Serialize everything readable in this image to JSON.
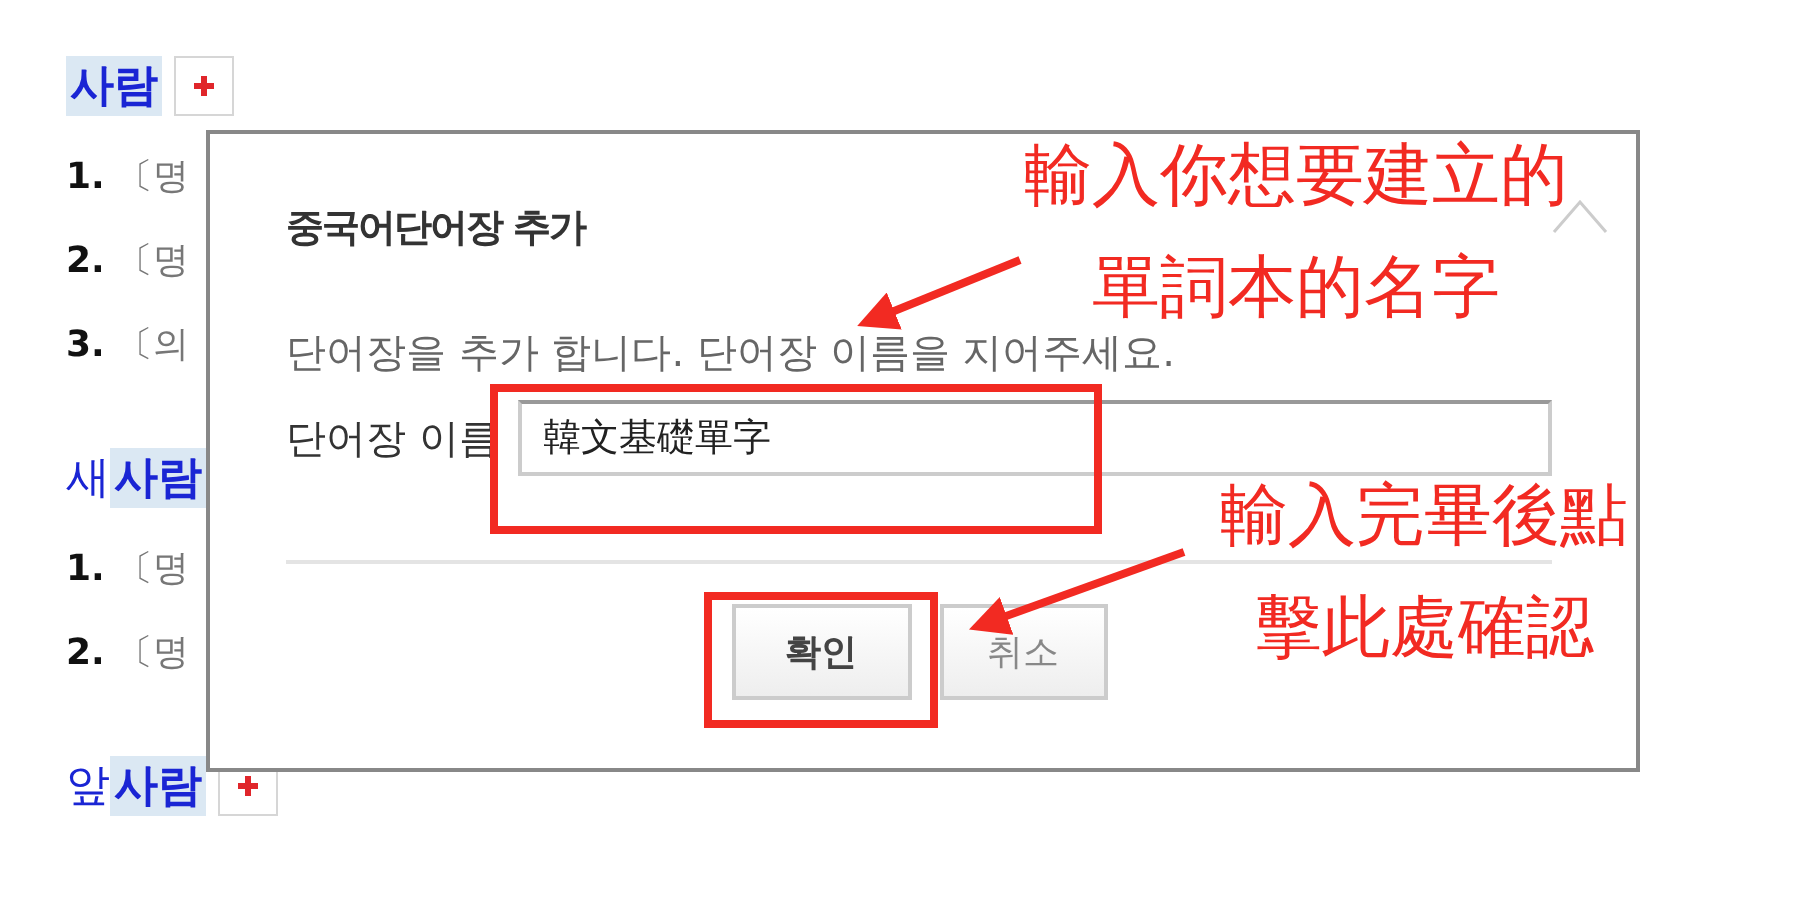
{
  "entries": [
    {
      "word": "사람",
      "add_button": true,
      "senses": [
        {
          "number": "1.",
          "text": "〔명"
        },
        {
          "number": "2.",
          "text": "〔명"
        },
        {
          "number": "3.",
          "text": "〔의"
        }
      ]
    },
    {
      "prefix": "새",
      "word": "사람",
      "senses": [
        {
          "number": "1.",
          "text": "〔명"
        },
        {
          "number": "2.",
          "text": "〔명"
        }
      ]
    },
    {
      "prefix": "앞",
      "word": "사람",
      "add_button": true
    }
  ],
  "dialog": {
    "title": "중국어단어장 추가",
    "description": "단어장을 추가 합니다. 단어장 이름을 지어주세요.",
    "field_label": "단어장 이름",
    "field_value": "韓文基礎單字",
    "buttons": [
      {
        "label": "확인",
        "kind": "confirm"
      },
      {
        "label": "취소",
        "kind": "cancel"
      }
    ]
  },
  "annotations": [
    {
      "lines": [
        "輸入你想要建立的",
        "單詞本的名字"
      ]
    },
    {
      "lines": [
        "輸入完畢後點",
        "擊此處確認"
      ]
    }
  ]
}
